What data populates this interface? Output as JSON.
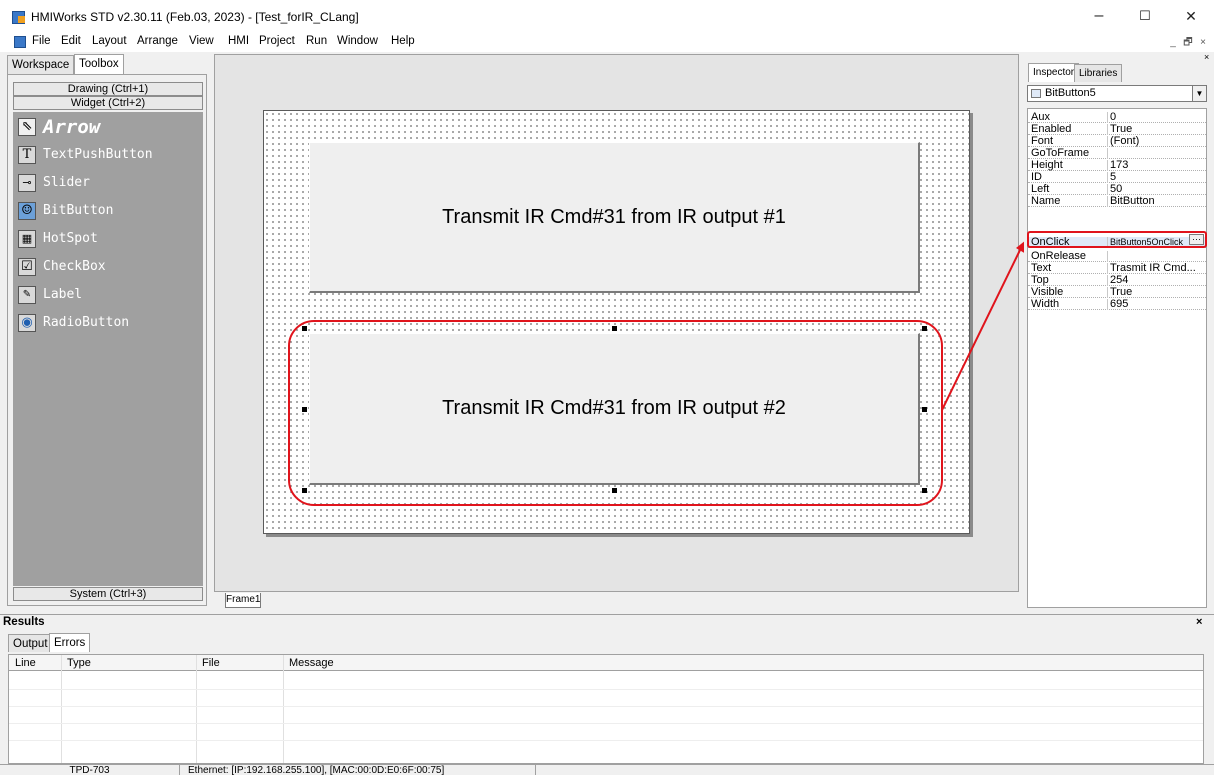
{
  "window": {
    "title": "HMIWorks STD v2.30.11 (Feb.03, 2023) - [Test_forIR_CLang]",
    "minimize": "–",
    "maximize": "☐",
    "close": "✕"
  },
  "menu": {
    "items": [
      "File",
      "Edit",
      "Layout",
      "Arrange",
      "View",
      "HMI",
      "Project",
      "Run",
      "Window",
      "Help"
    ],
    "mdi_min": "_",
    "mdi_restore": "🗗",
    "mdi_close": "×"
  },
  "left_panel": {
    "tabs": [
      "Workspace",
      "Toolbox"
    ],
    "categories": {
      "drawing": "Drawing (Ctrl+1)",
      "widget": "Widget (Ctrl+2)",
      "system": "System (Ctrl+3)"
    },
    "tools": [
      {
        "label": "Arrow",
        "icon": "arrow-icon"
      },
      {
        "label": "TextPushButton",
        "icon": "text-icon"
      },
      {
        "label": "Slider",
        "icon": "slider-icon"
      },
      {
        "label": "BitButton",
        "icon": "bitbutton-icon"
      },
      {
        "label": "HotSpot",
        "icon": "hotspot-icon"
      },
      {
        "label": "CheckBox",
        "icon": "checkbox-icon"
      },
      {
        "label": "Label",
        "icon": "label-icon"
      },
      {
        "label": "RadioButton",
        "icon": "radiobutton-icon"
      }
    ]
  },
  "canvas": {
    "button1": "Transmit IR Cmd#31 from IR output #1",
    "button2": "Transmit IR Cmd#31 from IR output #2",
    "frame_tab": "Frame1",
    "highlight_color": "#e0141c"
  },
  "inspector": {
    "tabs": [
      "Inspector",
      "Libraries"
    ],
    "selected_object": "BitButton5",
    "properties": [
      {
        "name": "Aux",
        "value": "0"
      },
      {
        "name": "Enabled",
        "value": "True"
      },
      {
        "name": "Font",
        "value": "(Font)"
      },
      {
        "name": "GoToFrame",
        "value": ""
      },
      {
        "name": "Height",
        "value": "173"
      },
      {
        "name": "ID",
        "value": "5"
      },
      {
        "name": "Left",
        "value": "50"
      },
      {
        "name": "Name",
        "value": "BitButton"
      },
      {
        "name": "OnClick",
        "value": "BitButton5OnClick"
      },
      {
        "name": "OnRelease",
        "value": ""
      },
      {
        "name": "Text",
        "value": "Trasmit IR Cmd..."
      },
      {
        "name": "Top",
        "value": "254"
      },
      {
        "name": "Visible",
        "value": "True"
      },
      {
        "name": "Width",
        "value": "695"
      }
    ],
    "ellipsis": "···"
  },
  "results": {
    "title": "Results",
    "close": "×",
    "tabs": [
      "Output",
      "Errors"
    ],
    "columns": [
      "Line",
      "Type",
      "File",
      "Message"
    ]
  },
  "status": {
    "device": "TPD-703",
    "connection": "Ethernet: [IP:192.168.255.100], [MAC:00:0D:E0:6F:00:75]"
  }
}
